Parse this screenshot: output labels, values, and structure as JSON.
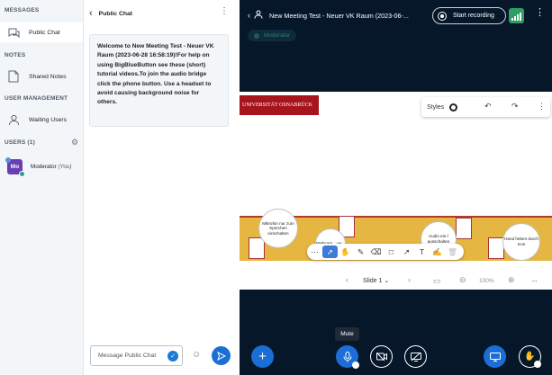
{
  "sidebar": {
    "messages_title": "MESSAGES",
    "public_chat": "Public Chat",
    "notes_title": "NOTES",
    "shared_notes": "Shared Notes",
    "user_mgmt_title": "USER MANAGEMENT",
    "waiting_users": "Waiting Users",
    "users_title": "USERS (1)",
    "user": {
      "initials": "Mo",
      "name": "Moderator",
      "you": "(You)"
    }
  },
  "chat": {
    "title": "Public Chat",
    "welcome": "Welcome to New Meeting Test - Neuer VK Raum (2023-06-28 16:58:19)!For help on using BigBlueButton see these (short) tutorial videos.To join the audio bridge click the phone button. Use a headset to avoid causing background noise for others.",
    "input_placeholder": "Message Public Chat"
  },
  "header": {
    "meeting_title": "New Meeting Test - Neuer VK Raum (2023-06-...",
    "record_label": "Start recording",
    "role_badge": "Moderator"
  },
  "presentation": {
    "logo_text": "UNIVERSITÄT OSNABRÜCK",
    "styles_label": "Styles",
    "bubbles": [
      "Mikrofon nur zum Sprechen einschalten",
      "Webcam... ve...",
      "Audio ein-/ ausschalten",
      "Hand heben durch Icon"
    ],
    "slide_label": "Slide 1",
    "zoom": "100%"
  },
  "controls": {
    "mute_tooltip": "Mute"
  },
  "colors": {
    "accent": "#1b6ed6",
    "sidebar_bg": "#f3f6f9",
    "main_bg": "#06172a",
    "record_ok": "#2e9e62"
  }
}
